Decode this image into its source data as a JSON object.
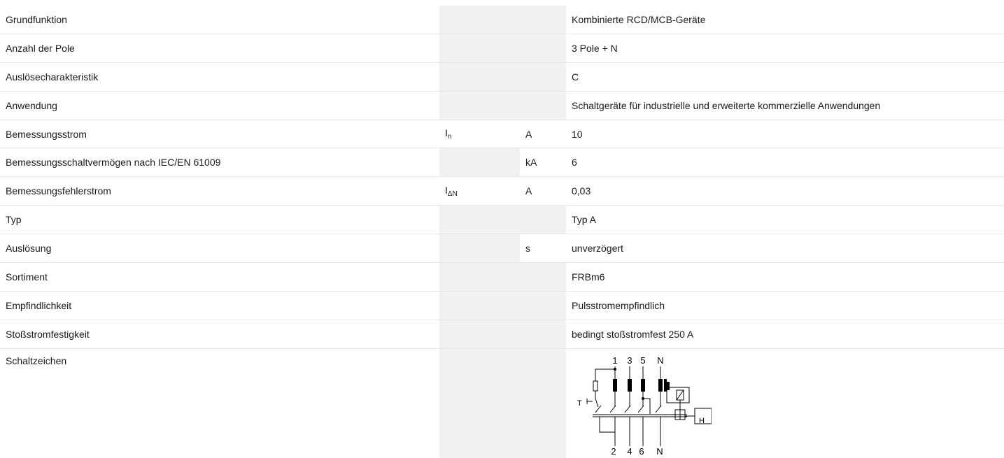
{
  "rows": [
    {
      "label": "Grundfunktion",
      "symbol": "",
      "symbol_sub": "",
      "unit": "",
      "value": "Kombinierte RCD/MCB-Geräte"
    },
    {
      "label": "Anzahl der Pole",
      "symbol": "",
      "symbol_sub": "",
      "unit": "",
      "value": "3 Pole + N"
    },
    {
      "label": "Auslösecharakteristik",
      "symbol": "",
      "symbol_sub": "",
      "unit": "",
      "value": "C"
    },
    {
      "label": "Anwendung",
      "symbol": "",
      "symbol_sub": "",
      "unit": "",
      "value": "Schaltgeräte für industrielle und erweiterte kommerzielle Anwendungen"
    },
    {
      "label": "Bemessungsstrom",
      "symbol": "I",
      "symbol_sub": "n",
      "unit": "A",
      "value": "10"
    },
    {
      "label": "Bemessungsschaltvermögen nach IEC/EN 61009",
      "symbol": "",
      "symbol_sub": "",
      "unit": "kA",
      "value": "6"
    },
    {
      "label": "Bemessungsfehlerstrom",
      "symbol": "I",
      "symbol_sub": "ΔN",
      "unit": "A",
      "value": "0,03"
    },
    {
      "label": "Typ",
      "symbol": "",
      "symbol_sub": "",
      "unit": "",
      "value": "Typ A"
    },
    {
      "label": "Auslösung",
      "symbol": "",
      "symbol_sub": "",
      "unit": "s",
      "value": "unverzögert"
    },
    {
      "label": "Sortiment",
      "symbol": "",
      "symbol_sub": "",
      "unit": "",
      "value": "FRBm6"
    },
    {
      "label": "Empfindlichkeit",
      "symbol": "",
      "symbol_sub": "",
      "unit": "",
      "value": "Pulsstromempfindlich"
    },
    {
      "label": "Stoßstromfestigkeit",
      "symbol": "",
      "symbol_sub": "",
      "unit": "",
      "value": "bedingt stoßstromfest 250 A"
    }
  ],
  "schematic_row": {
    "label": "Schaltzeichen"
  },
  "diagram": {
    "top_terminals": [
      "1",
      "3",
      "5",
      "N"
    ],
    "bottom_terminals": [
      "2",
      "4",
      "6",
      "N"
    ],
    "test_label": "T",
    "box_label": "H"
  }
}
